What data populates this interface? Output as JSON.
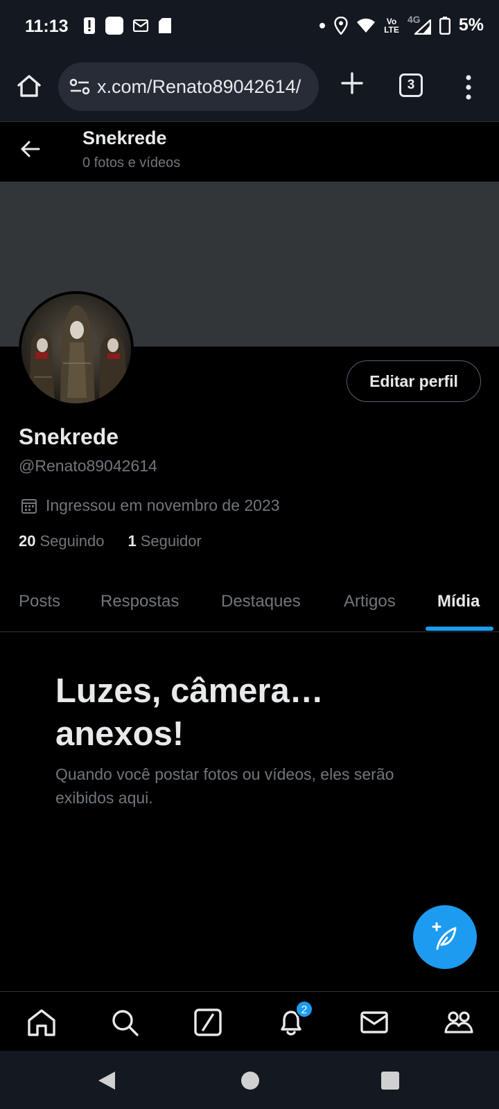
{
  "status_bar": {
    "time": "11:13",
    "battery": "5%",
    "network_label_top": "Vo",
    "network_label_bottom": "LTE",
    "network_type": "4G"
  },
  "browser": {
    "url": "x.com/Renato89042614/",
    "tab_count": "3"
  },
  "header": {
    "title": "Snekrede",
    "subtitle": "0 fotos e vídeos"
  },
  "profile": {
    "edit_label": "Editar perfil",
    "display_name": "Snekrede",
    "handle": "@Renato89042614",
    "joined": "Ingressou em novembro de 2023",
    "following_count": "20",
    "following_label": "Seguindo",
    "followers_count": "1",
    "followers_label": "Seguidor"
  },
  "tabs": [
    {
      "label": "Posts",
      "active": false
    },
    {
      "label": "Respostas",
      "active": false
    },
    {
      "label": "Destaques",
      "active": false
    },
    {
      "label": "Artigos",
      "active": false
    },
    {
      "label": "Mídia",
      "active": true
    }
  ],
  "empty_state": {
    "title": "Luzes, câmera… anexos!",
    "description": "Quando você postar fotos ou vídeos, eles serão exibidos aqui."
  },
  "bottom_nav": {
    "items": [
      "home-icon",
      "search-icon",
      "grok-icon",
      "bell-icon",
      "mail-icon",
      "communities-icon"
    ],
    "notification_badge": "2"
  },
  "colors": {
    "accent": "#1d9bf0",
    "background": "#000000",
    "banner": "#333639",
    "secondary_text": "#71767b"
  }
}
